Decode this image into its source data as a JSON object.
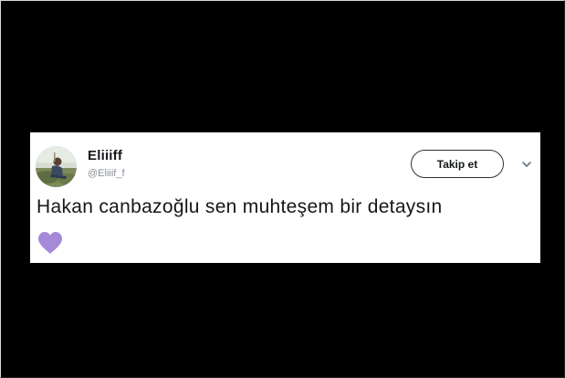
{
  "tweet": {
    "display_name": "Eliiiff",
    "handle": "@Eliiif_f",
    "follow_label": "Takip et",
    "text": "Hakan canbazoğlu sen muhteşem bir detaysın",
    "emoji_icon": "purple-heart-icon",
    "menu_icon": "chevron-down-icon"
  },
  "colors": {
    "background": "#000000",
    "card": "#ffffff",
    "text": "#14171a",
    "handle": "#8a9097",
    "heart": "#a58ad8"
  }
}
